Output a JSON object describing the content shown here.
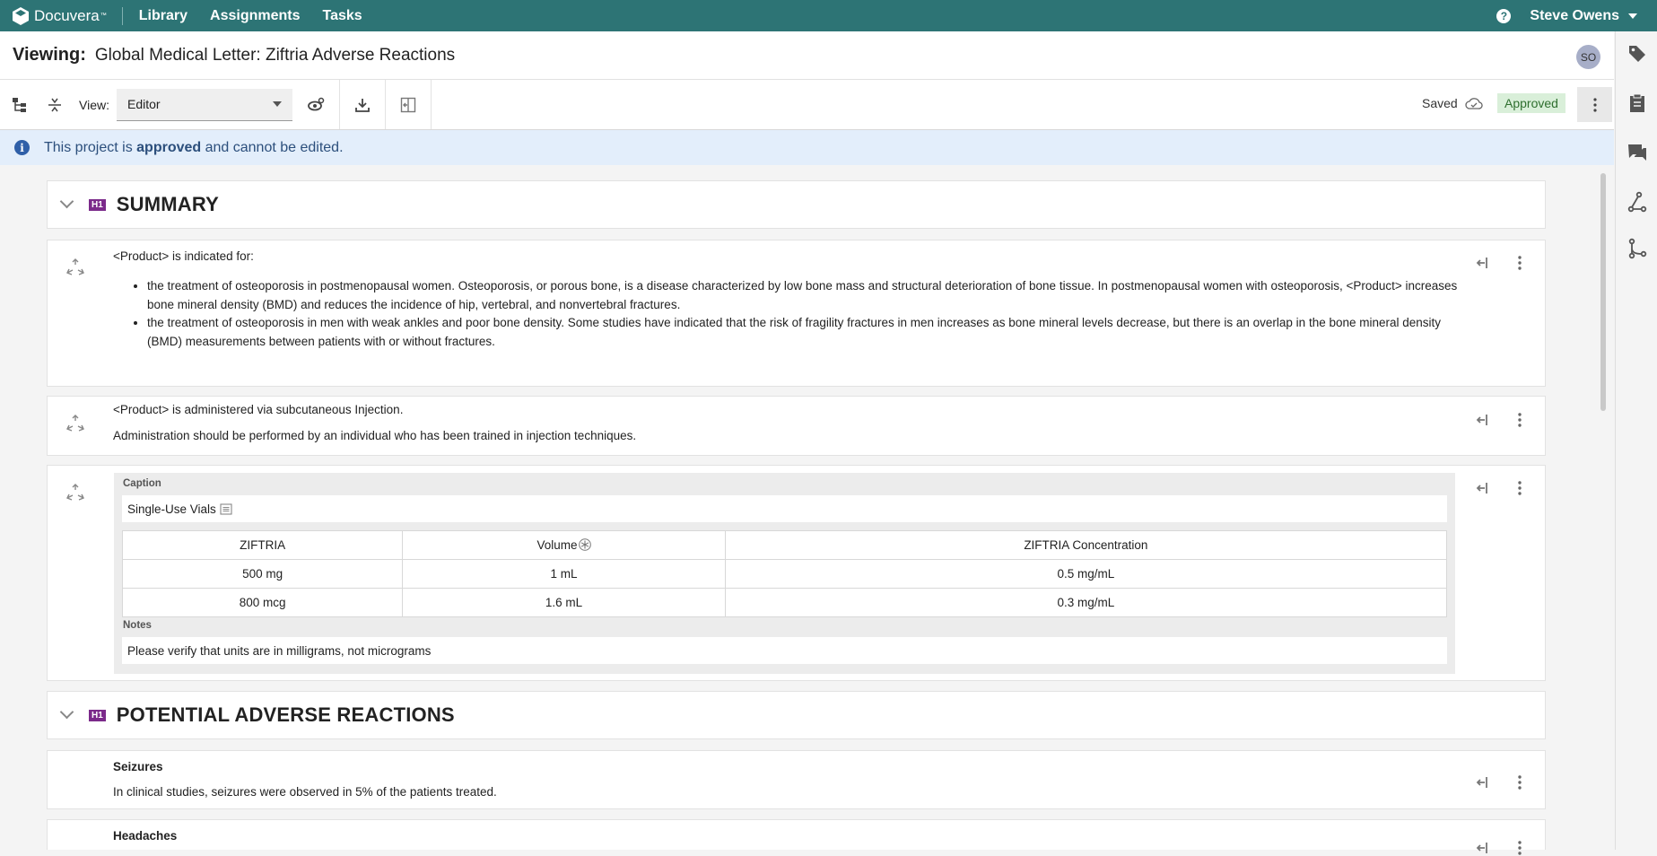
{
  "nav": {
    "brand": "Docuvera",
    "brand_tm": "™",
    "links": [
      "Library",
      "Assignments",
      "Tasks"
    ],
    "help_symbol": "?",
    "user": "Steve Owens"
  },
  "header": {
    "viewing_label": "Viewing:",
    "title": "Global Medical Letter: Ziftria Adverse Reactions",
    "avatar_initials": "SO"
  },
  "toolbar": {
    "view_label": "View:",
    "view_value": "Editor",
    "saved_label": "Saved",
    "status_badge": "Approved"
  },
  "banner": {
    "prefix": "This project is ",
    "bold": "approved",
    "suffix": " and cannot be edited."
  },
  "summary": {
    "heading_tag": "H1",
    "heading": "SUMMARY",
    "indication_intro": "<Product> is indicated for:",
    "bullets": [
      "the treatment of osteoporosis in postmenopausal women. Osteoporosis, or porous bone, is a disease characterized by low bone mass and structural deterioration of bone tissue.  In postmenopausal women with osteoporosis, <Product> increases bone mineral density (BMD) and reduces the incidence of hip, vertebral, and nonvertebral fractures.",
      "the treatment of osteoporosis in men with weak ankles and poor bone density.  Some studies have indicated that the risk of fragility fractures in men increases as bone mineral levels decrease, but there is an overlap in the bone mineral density (BMD) measurements between patients with or without fractures."
    ],
    "admin_line1": "<Product> is administered via subcutaneous Injection.",
    "admin_line2": "Administration should be performed by an individual who has been trained in injection techniques."
  },
  "table_block": {
    "caption_label": "Caption",
    "caption": "Single-Use Vials",
    "headers": [
      "ZIFTRIA",
      "Volume",
      "ZIFTRIA Concentration"
    ],
    "rows": [
      [
        "500 mg",
        "1 mL",
        "0.5 mg/mL"
      ],
      [
        "800 mcg",
        "1.6 mL",
        "0.3 mg/mL"
      ]
    ],
    "notes_label": "Notes",
    "notes": "Please verify that units are in milligrams, not micrograms"
  },
  "adverse": {
    "heading_tag": "H1",
    "heading": "POTENTIAL ADVERSE REACTIONS",
    "seizures_title": "Seizures",
    "seizures_text": "In clinical studies, seizures were observed in 5% of the patients treated.",
    "headaches_title": "Headaches"
  },
  "colors": {
    "nav_bg": "#2d7475",
    "h1_badge": "#7b2a8a",
    "banner_bg": "#e3eefb",
    "approved_bg": "#d9efd9"
  }
}
